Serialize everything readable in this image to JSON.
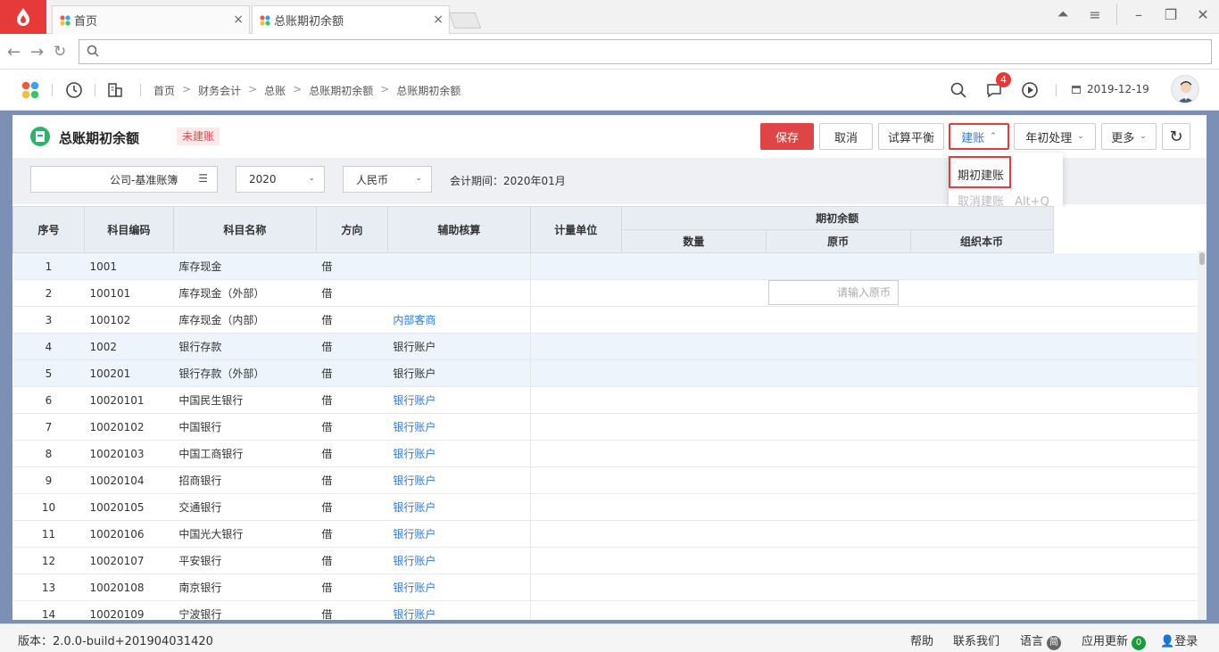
{
  "browser": {
    "tabs": [
      {
        "label": "首页",
        "close": "×"
      },
      {
        "label": "总账期初余额",
        "close": "×"
      }
    ],
    "window_controls": [
      "⏶",
      "≡",
      "–",
      "❐",
      "✕"
    ]
  },
  "header": {
    "breadcrumbs": [
      "首页",
      "财务会计",
      "总账",
      "总账期初余额",
      "总账期初余额"
    ],
    "breadcrumb_separator": ">",
    "message_count": "4",
    "date": "2019-12-19"
  },
  "page": {
    "title": "总账期初余额",
    "status": "未建账"
  },
  "toolbar": {
    "save": "保存",
    "cancel": "取消",
    "trial_balance": "试算平衡",
    "build": "建账",
    "year_start": "年初处理",
    "more": "更多"
  },
  "dropdown": {
    "items": [
      {
        "label": "期初建账",
        "shortcut": ""
      },
      {
        "label": "取消建账",
        "shortcut": "Alt+Q"
      }
    ]
  },
  "filters": {
    "book": "公司-基准账簿",
    "year": "2020",
    "currency": "人民币",
    "period": "会计期间：2020年01月"
  },
  "table": {
    "headers": {
      "seq": "序号",
      "code": "科目编码",
      "name": "科目名称",
      "direction": "方向",
      "aux": "辅助核算",
      "unit": "计量单位",
      "opening": "期初余额",
      "qty": "数量",
      "orig": "原币",
      "org": "组织本币"
    },
    "input_placeholder": "请输入原币",
    "rows": [
      {
        "seq": "1",
        "code": "1001",
        "name": "库存现金",
        "dir": "借",
        "aux": "",
        "link": false,
        "hl": true
      },
      {
        "seq": "2",
        "code": "100101",
        "name": "库存现金（外部）",
        "dir": "借",
        "aux": "",
        "link": false,
        "hl": false
      },
      {
        "seq": "3",
        "code": "100102",
        "name": "库存现金（内部）",
        "dir": "借",
        "aux": "内部客商",
        "link": true,
        "hl": false
      },
      {
        "seq": "4",
        "code": "1002",
        "name": "银行存款",
        "dir": "借",
        "aux": "银行账户",
        "link": false,
        "hl": true
      },
      {
        "seq": "5",
        "code": "100201",
        "name": "银行存款（外部）",
        "dir": "借",
        "aux": "银行账户",
        "link": false,
        "hl": true
      },
      {
        "seq": "6",
        "code": "10020101",
        "name": "中国民生银行",
        "dir": "借",
        "aux": "银行账户",
        "link": true,
        "hl": false
      },
      {
        "seq": "7",
        "code": "10020102",
        "name": "中国银行",
        "dir": "借",
        "aux": "银行账户",
        "link": true,
        "hl": false
      },
      {
        "seq": "8",
        "code": "10020103",
        "name": "中国工商银行",
        "dir": "借",
        "aux": "银行账户",
        "link": true,
        "hl": false
      },
      {
        "seq": "9",
        "code": "10020104",
        "name": "招商银行",
        "dir": "借",
        "aux": "银行账户",
        "link": true,
        "hl": false
      },
      {
        "seq": "10",
        "code": "10020105",
        "name": "交通银行",
        "dir": "借",
        "aux": "银行账户",
        "link": true,
        "hl": false
      },
      {
        "seq": "11",
        "code": "10020106",
        "name": "中国光大银行",
        "dir": "借",
        "aux": "银行账户",
        "link": true,
        "hl": false
      },
      {
        "seq": "12",
        "code": "10020107",
        "name": "平安银行",
        "dir": "借",
        "aux": "银行账户",
        "link": true,
        "hl": false
      },
      {
        "seq": "13",
        "code": "10020108",
        "name": "南京银行",
        "dir": "借",
        "aux": "银行账户",
        "link": true,
        "hl": false
      },
      {
        "seq": "14",
        "code": "10020109",
        "name": "宁波银行",
        "dir": "借",
        "aux": "银行账户",
        "link": true,
        "hl": false
      }
    ]
  },
  "footer": {
    "version": "版本：2.0.0-build+201904031420",
    "help": "帮助",
    "contact": "联系我们",
    "language": "语言",
    "language_badge": "简",
    "update": "应用更新",
    "update_count": "0",
    "login": "登录"
  },
  "colors": {
    "accent": "#e04545",
    "link": "#2f7bd6",
    "panel_bg": "#7c8fb4"
  }
}
